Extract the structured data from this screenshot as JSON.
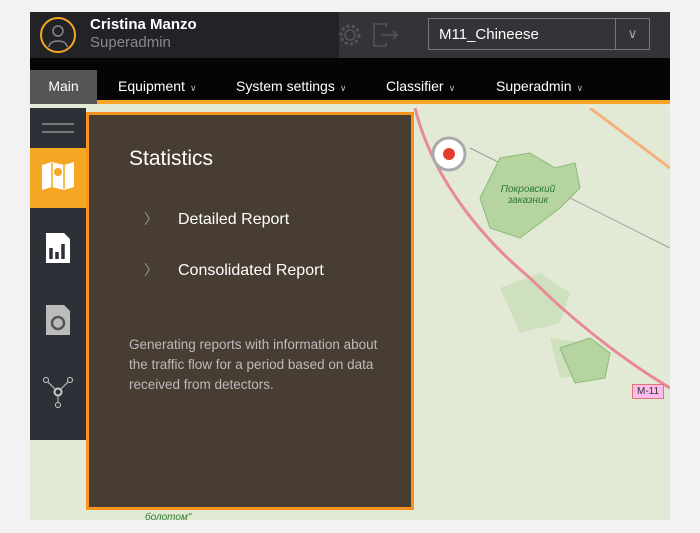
{
  "user": {
    "name": "Cristina Manzo",
    "role": "Superadmin"
  },
  "header": {
    "selected_object": "M11_Chineese",
    "icons": [
      "gear-icon",
      "logout-icon"
    ]
  },
  "nav": {
    "items": [
      {
        "label": "Main",
        "active": true
      },
      {
        "label": "Equipment"
      },
      {
        "label": "System settings"
      },
      {
        "label": "Classifier"
      },
      {
        "label": "Superadmin"
      }
    ]
  },
  "sidebar": {
    "items": [
      "menu-icon",
      "map-icon",
      "report-icon",
      "camera-icon",
      "network-icon"
    ],
    "active": "map-icon"
  },
  "panel": {
    "title": "Statistics",
    "items": [
      "Detailed Report",
      "Consolidated Report"
    ],
    "description": "Generating reports with information about the traffic flow for a period based on data received from detectors."
  },
  "map": {
    "labels": {
      "reserve": "Покровский заказник",
      "road": "M-11",
      "swamp": "болотом\""
    }
  },
  "colors": {
    "accent": "#f7931e",
    "panel": "#473d33",
    "header": "#222327"
  }
}
